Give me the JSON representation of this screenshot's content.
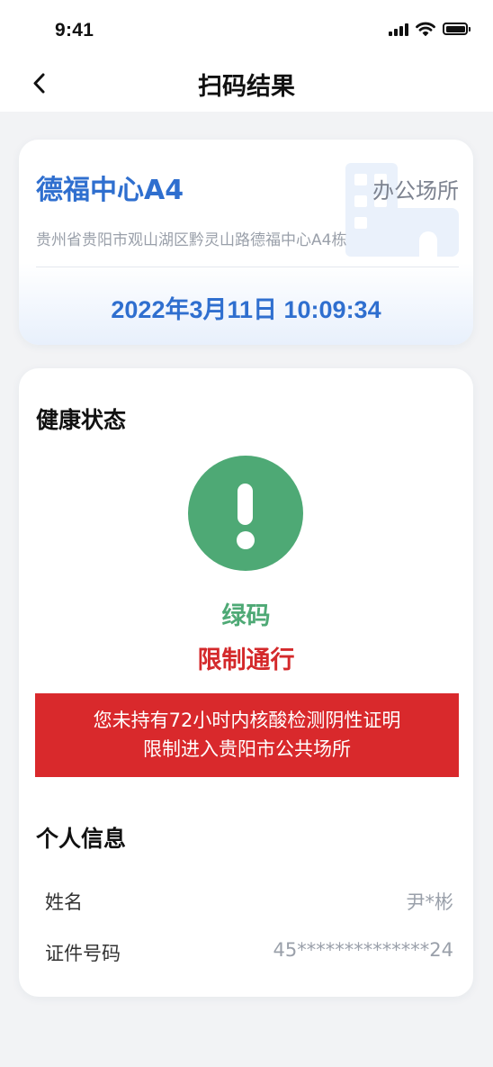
{
  "status_bar": {
    "time": "9:41"
  },
  "nav": {
    "title": "扫码结果",
    "back_icon": "chevron-left-icon"
  },
  "place": {
    "name": "德福中心A4",
    "type": "办公场所",
    "address": "贵州省贵阳市观山湖区黔灵山路德福中心A4栋",
    "scan_time": "2022年3月11日 10:09:34",
    "icon": "building-icon"
  },
  "health": {
    "section_title": "健康状态",
    "status_icon": "exclamation-icon",
    "code_color": "绿码",
    "pass_status": "限制通行",
    "warning_line1": "您未持有72小时内核酸检测阴性证明",
    "warning_line2": "限制进入贵阳市公共场所"
  },
  "personal": {
    "section_title": "个人信息",
    "name_label": "姓名",
    "name_value": "尹*彬",
    "id_label": "证件号码",
    "id_value": "45**************24"
  },
  "colors": {
    "accent_blue": "#2f6fcf",
    "green_code": "#4ea975",
    "warning_red": "#d9292c"
  }
}
